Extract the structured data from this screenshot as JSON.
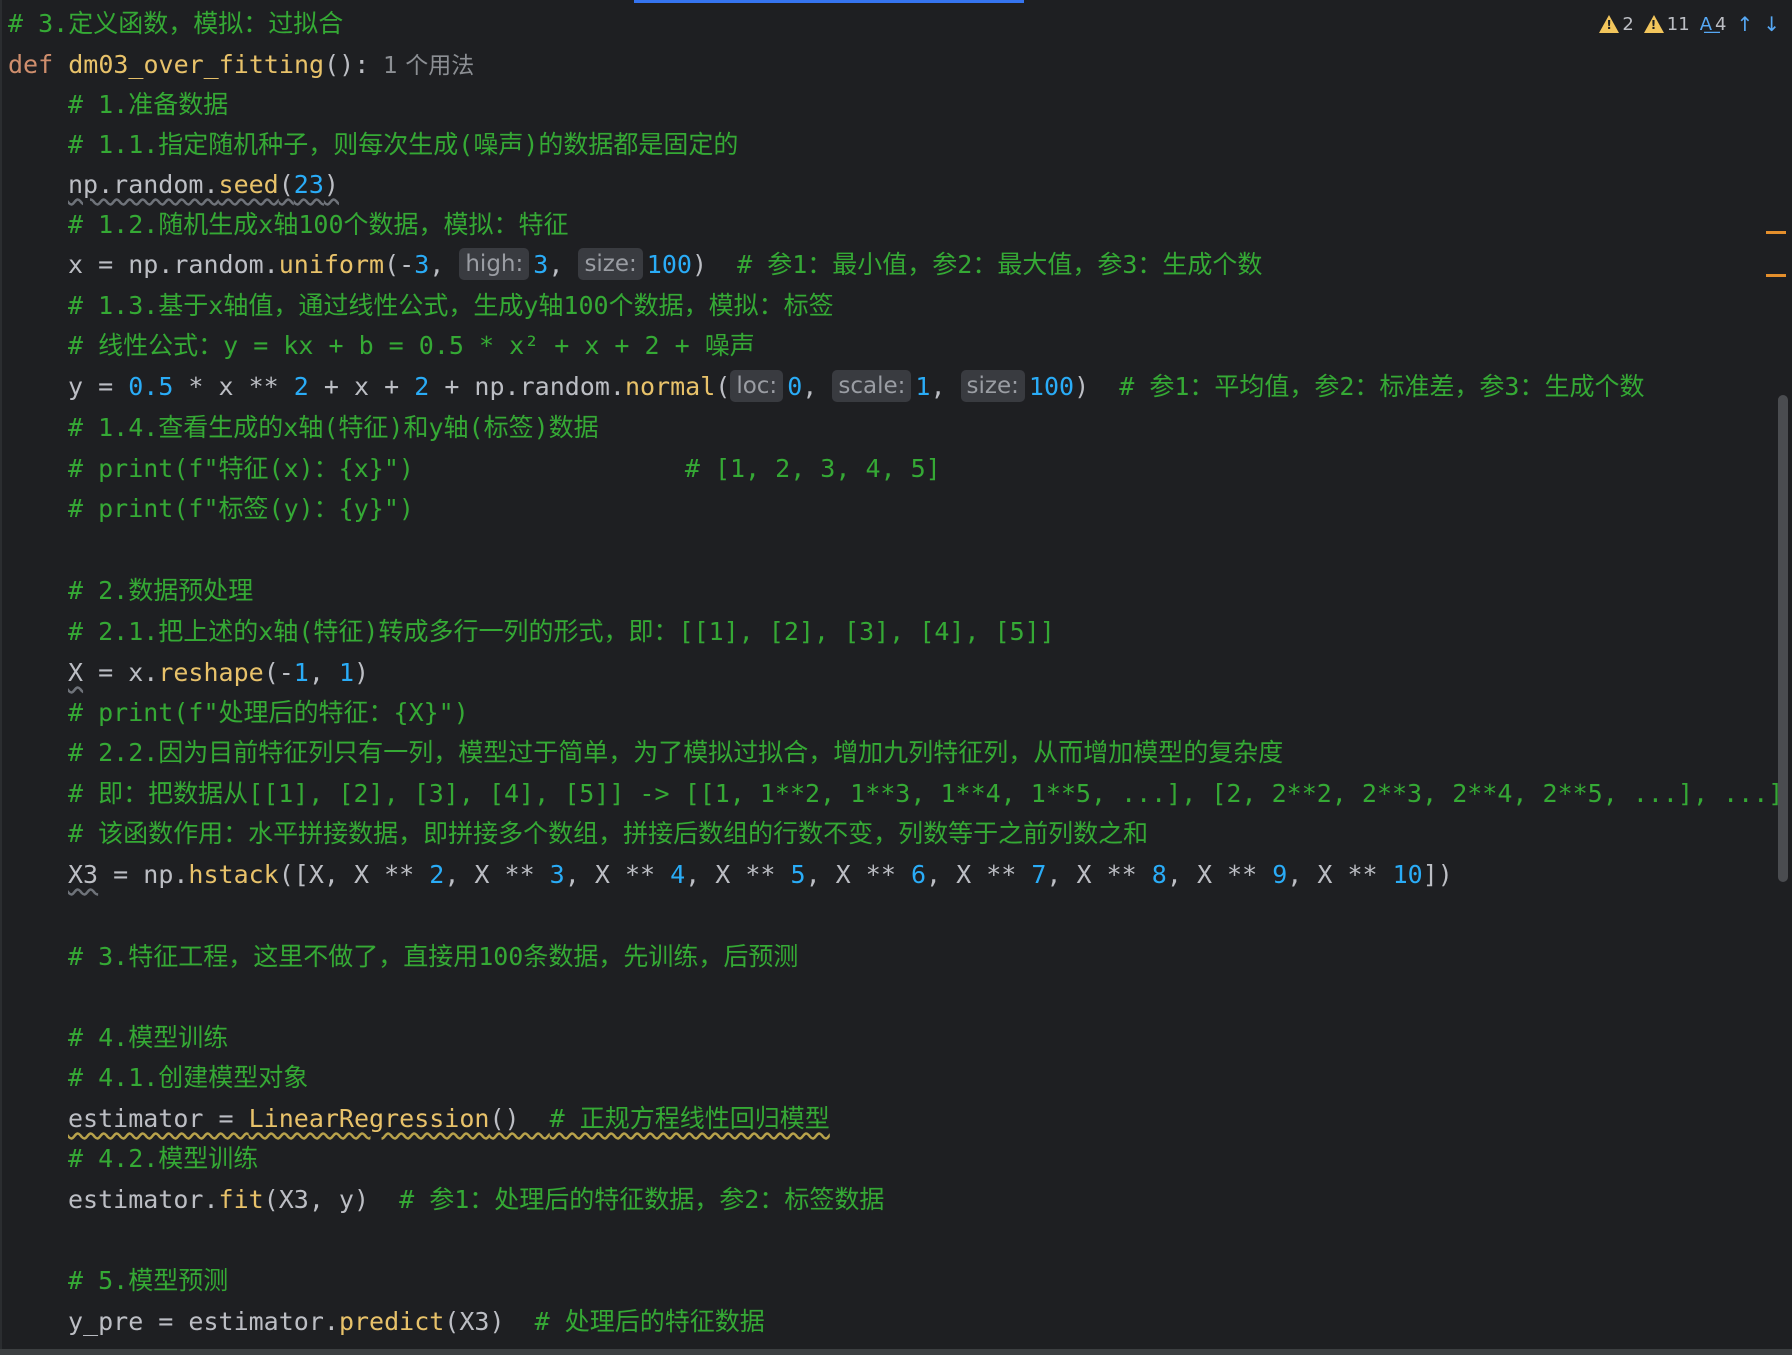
{
  "status": {
    "warnings_weak": "2",
    "warnings": "11",
    "typos": "4"
  },
  "colors": {
    "background": "#1e1f22",
    "comment": "#35a935",
    "keyword": "#cf8e6d",
    "function": "#56a8f5",
    "number": "#2aacf7"
  },
  "lines": {
    "l1": "# 3.定义函数，模拟：过拟合",
    "l2_kw": "def ",
    "l2_name": "dm03_over_fitting",
    "l2_rest": "():",
    "l2_usages": "1 个用法",
    "l3": "# 1.准备数据",
    "l4": "# 1.1.指定随机种子，则每次生成(噪声)的数据都是固定的",
    "l5_a": "np.random.",
    "l5_fn": "seed",
    "l5_p1": "(",
    "l5_n": "23",
    "l5_p2": ")",
    "l6": "# 1.2.随机生成x轴100个数据，模拟：特征",
    "l7_a": "x = np.random.",
    "l7_fn": "uniform",
    "l7_b": "(-",
    "l7_n1": "3",
    "l7_c": ", ",
    "l7_h1": "high:",
    "l7_n2": "3",
    "l7_d": ", ",
    "l7_h2": "size:",
    "l7_n3": "100",
    "l7_e": ")  ",
    "l7_cm": "# 参1：最小值，参2：最大值，参3：生成个数",
    "l8": "# 1.3.基于x轴值，通过线性公式，生成y轴100个数据，模拟：标签",
    "l9": "# 线性公式：y = kx + b = 0.5 * x² + x + 2 + 噪声",
    "l10_a": "y = ",
    "l10_n1": "0.5",
    "l10_b": " * x ** ",
    "l10_n2": "2",
    "l10_c": " + x + ",
    "l10_n3": "2",
    "l10_d": " + np.random.",
    "l10_fn": "normal",
    "l10_e": "(",
    "l10_h1": "loc:",
    "l10_n4": "0",
    "l10_f": ", ",
    "l10_h2": "scale:",
    "l10_n5": "1",
    "l10_g": ", ",
    "l10_h3": "size:",
    "l10_n6": "100",
    "l10_h": ")  ",
    "l10_cm": "# 参1：平均值，参2：标准差，参3：生成个数",
    "l11": "# 1.4.查看生成的x轴(特征)和y轴(标签)数据",
    "l12": "# print(f\"特征(x)：{x}\")                  # [1, 2, 3, 4, 5]",
    "l13": "# print(f\"标签(y)：{y}\")",
    "l14": "# 2.数据预处理",
    "l15": "# 2.1.把上述的x轴(特征)转成多行一列的形式，即：[[1], [2], [3], [4], [5]]",
    "l16_a": "X",
    "l16_b": " = x.",
    "l16_fn": "reshape",
    "l16_c": "(-",
    "l16_n1": "1",
    "l16_d": ", ",
    "l16_n2": "1",
    "l16_e": ")",
    "l17": "# print(f\"处理后的特征：{X}\")",
    "l18": "# 2.2.因为目前特征列只有一列，模型过于简单，为了模拟过拟合，增加九列特征列，从而增加模型的复杂度",
    "l19": "# 即：把数据从[[1], [2], [3], [4], [5]] -> [[1, 1**2, 1**3, 1**4, 1**5, ...], [2, 2**2, 2**3, 2**4, 2**5, ...], ...]",
    "l20": "# 该函数作用：水平拼接数据，即拼接多个数组，拼接后数组的行数不变，列数等于之前列数之和",
    "l21_a": "X3",
    "l21_b": " = np.",
    "l21_fn": "hstack",
    "l21_c": "([X, X ** ",
    "l21_n2": "2",
    "l21_s2": ", X ** ",
    "l21_n3": "3",
    "l21_s3": ", X ** ",
    "l21_n4": "4",
    "l21_s4": ", X ** ",
    "l21_n5": "5",
    "l21_s5": ", X ** ",
    "l21_n6": "6",
    "l21_s6": ", X ** ",
    "l21_n7": "7",
    "l21_s7": ", X ** ",
    "l21_n8": "8",
    "l21_s8": ", X ** ",
    "l21_n9": "9",
    "l21_s9": ", X ** ",
    "l21_n10": "10",
    "l21_e": "])",
    "l22": "# 3.特征工程，这里不做了，直接用100条数据，先训练，后预测",
    "l23": "# 4.模型训练",
    "l24": "# 4.1.创建模型对象",
    "l25_a": "estimator = ",
    "l25_fn": "LinearRegression",
    "l25_b": "()  ",
    "l25_cm": "# 正规方程线性回归模型",
    "l26": "# 4.2.模型训练",
    "l27_a": "estimator.",
    "l27_fn": "fit",
    "l27_b": "(X3, y)  ",
    "l27_cm": "# 参1：处理后的特征数据，参2：标签数据",
    "l28": "# 5.模型预测",
    "l29_a": "y_pre = estimator.",
    "l29_fn": "predict",
    "l29_b": "(X3)  ",
    "l29_cm": "# 处理后的特征数据"
  }
}
